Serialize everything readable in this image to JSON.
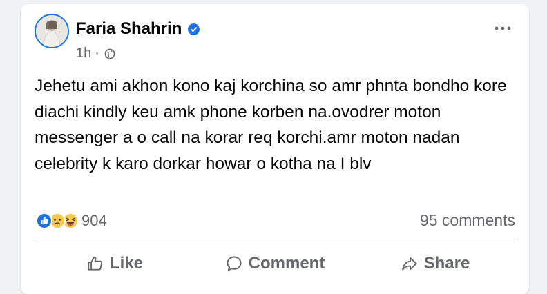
{
  "post": {
    "author": "Faria Shahrin",
    "verified_icon": "verified-badge-icon",
    "time": "1h",
    "separator": "·",
    "audience_icon": "globe-icon",
    "more_icon": "more-horizontal-icon",
    "text": "Jehetu ami akhon kono kaj korchina so amr phnta bondho kore diachi kindly keu amk phone korben na.ovodrer moton messenger a o call na korar req korchi.amr moton nadan celebrity k karo dorkar howar o kotha na I blv"
  },
  "stats": {
    "reaction_icons": [
      "like-reaction-icon",
      "sad-reaction-icon",
      "haha-reaction-icon"
    ],
    "reactions": "904",
    "comments": "95 comments"
  },
  "actions": {
    "like": "Like",
    "comment": "Comment",
    "share": "Share"
  },
  "colors": {
    "accent": "#1b74e4",
    "secondary_text": "#65676b",
    "background": "#f0f2f5"
  }
}
